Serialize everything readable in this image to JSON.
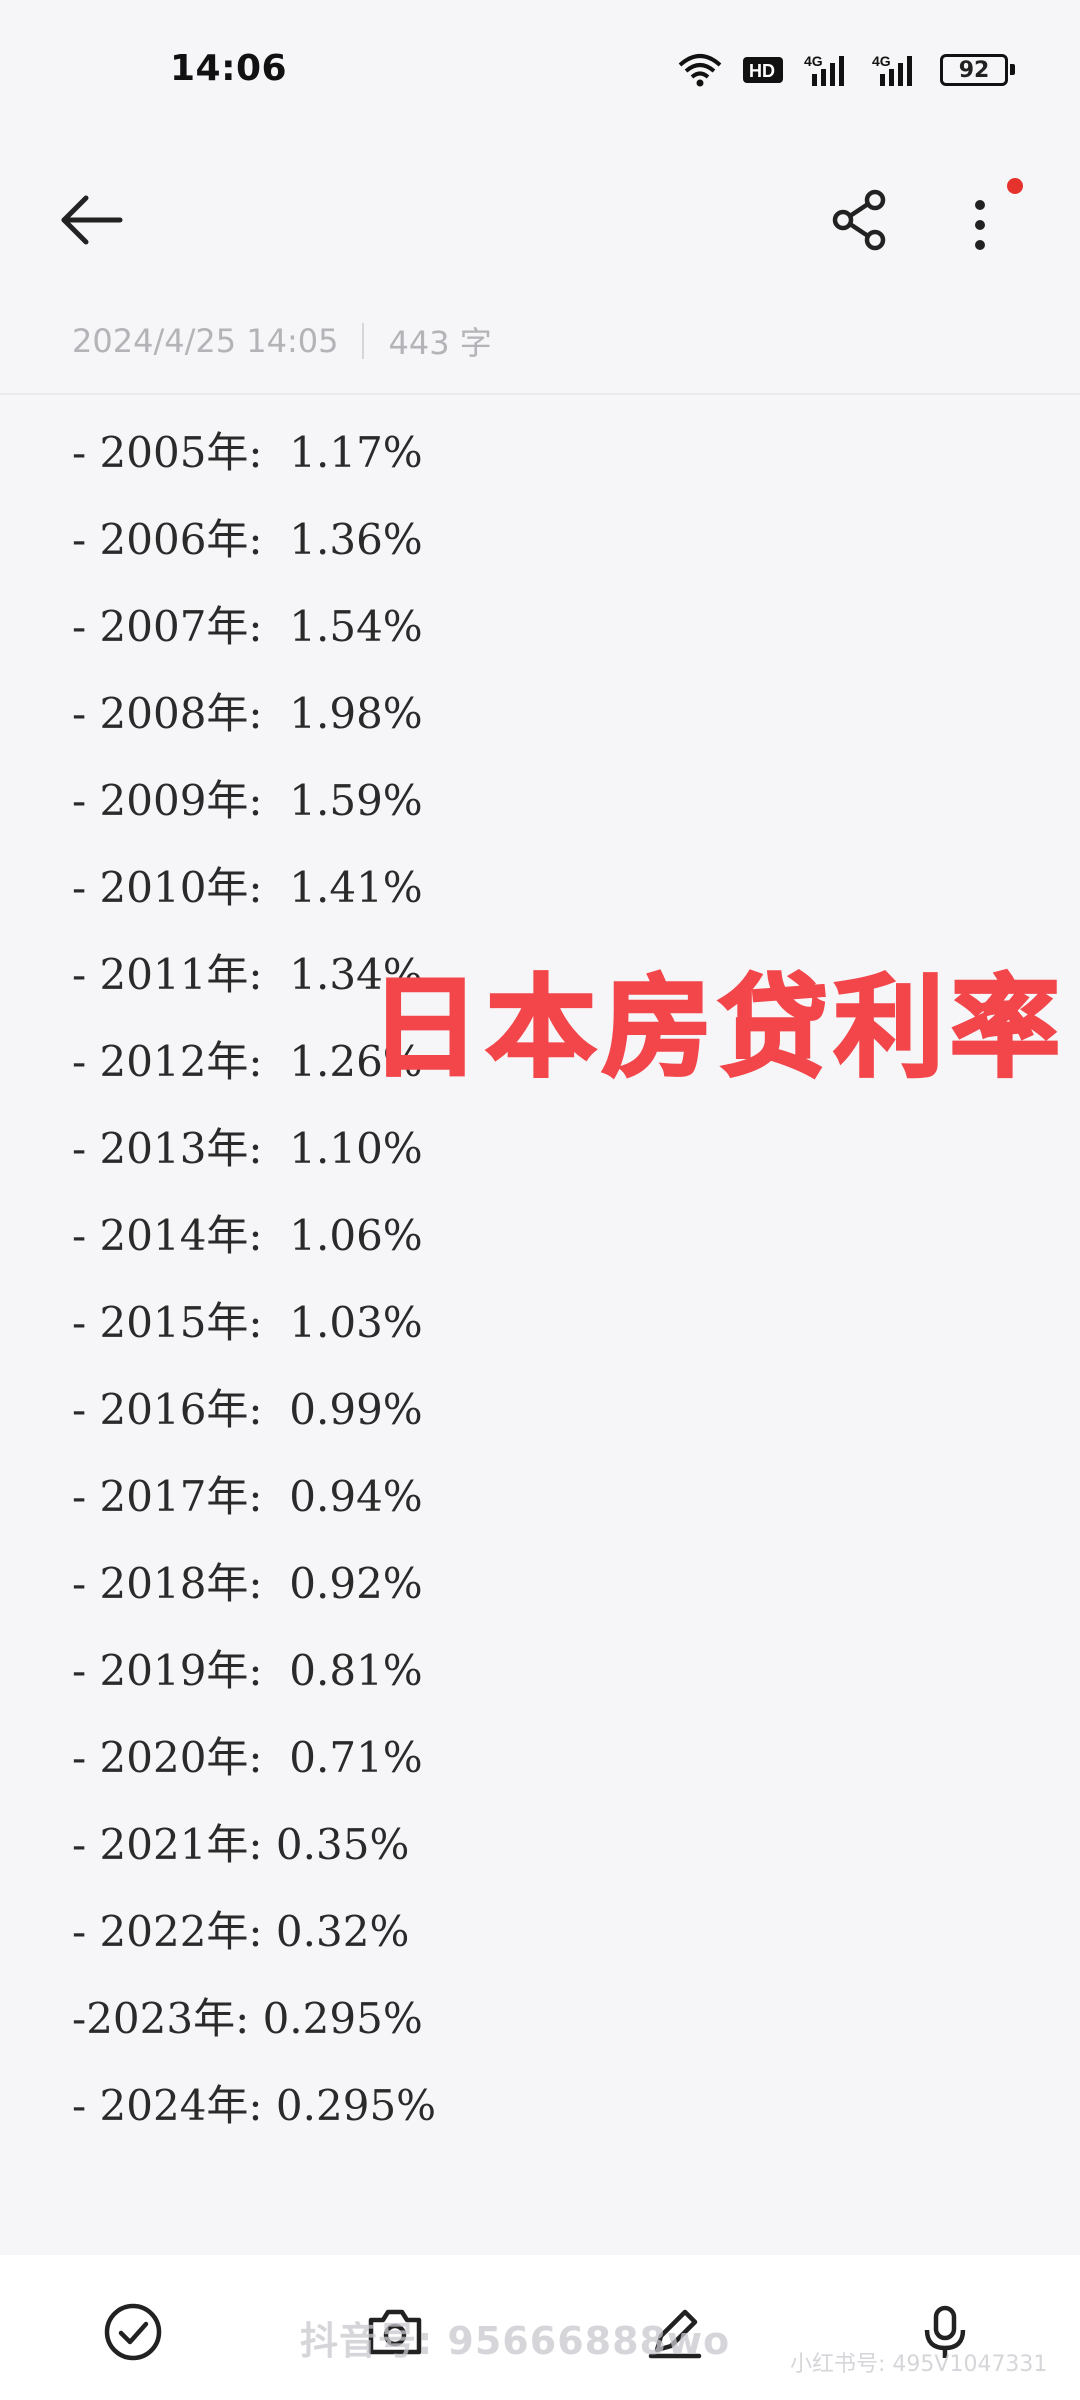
{
  "status_bar": {
    "time": "14:06",
    "network_hd": "HD",
    "network_1": "4G",
    "network_2": "4G",
    "battery": "92"
  },
  "note_meta": {
    "date": "2024/4/25 14:05",
    "word_count": "443 字"
  },
  "lines": [
    "- 2005年:  1.17%",
    "- 2006年:  1.36%",
    "- 2007年:  1.54%",
    "- 2008年:  1.98%",
    "- 2009年:  1.59%",
    "- 2010年:  1.41%",
    "- 2011年:  1.34%",
    "- 2012年:  1.26%",
    "- 2013年:  1.10%",
    "- 2014年:  1.06%",
    "- 2015年:  1.03%",
    "- 2016年:  0.99%",
    "- 2017年:  0.94%",
    "- 2018年:  0.92%",
    "- 2019年:  0.81%",
    "- 2020年:  0.71%",
    "- 2021年: 0.35%",
    "- 2022年: 0.32%",
    "-2023年: 0.295%",
    "- 2024年: 0.295%"
  ],
  "overlay_title": "日本房贷利率",
  "watermark": "抖音号: 95666888wo",
  "watermark_small": "小红书号: 495V1047331",
  "colors": {
    "overlay": "#f2464b",
    "notification_dot": "#e5322d",
    "background": "#f6f6f8"
  },
  "icons": {
    "back": "arrow-left-icon",
    "share": "share-icon",
    "more": "more-vertical-icon",
    "check": "check-circle-icon",
    "camera": "camera-icon",
    "pen": "pen-icon",
    "mic": "microphone-icon"
  }
}
